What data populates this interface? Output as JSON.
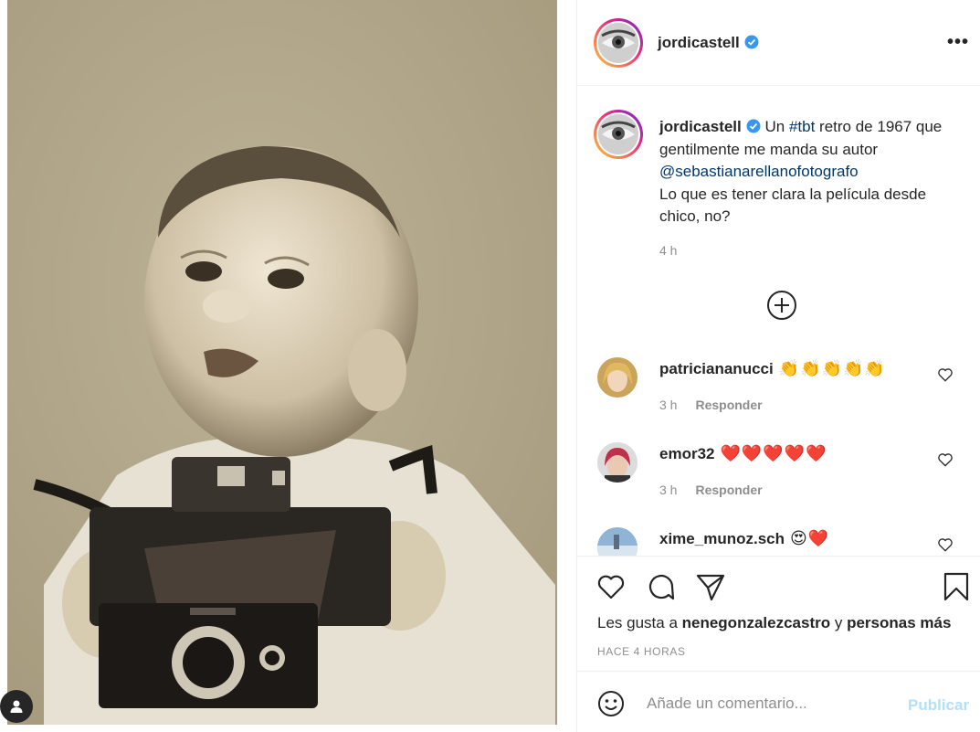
{
  "post": {
    "author": "jordicastell",
    "verified": true,
    "more_icon": "more-horizontal-icon",
    "caption": {
      "text_1": "Un ",
      "hashtag": "#tbt",
      "text_2": " retro de 1967 que gentilmente me manda su autor ",
      "mention": "@sebastianarellanofotografo",
      "text_3": "Lo que es tener clara la película desde chico, no?",
      "time": "4 h"
    },
    "load_more_icon": "plus-circle-icon"
  },
  "comments": [
    {
      "user": "patriciananucci",
      "emoji": "👏👏👏👏👏",
      "time": "3 h",
      "reply": "Responder"
    },
    {
      "user": "emor32",
      "emoji": "❤️❤️❤️❤️❤️",
      "time": "3 h",
      "reply": "Responder"
    },
    {
      "user": "xime_munoz.sch",
      "emoji": "😍❤️",
      "time": "",
      "reply": ""
    }
  ],
  "actions": {
    "icons": [
      "heart-icon",
      "comment-icon",
      "share-icon",
      "bookmark-icon"
    ],
    "likes_prefix": "Les gusta a ",
    "likes_user": "nenegonzalezcastro",
    "likes_mid": " y ",
    "likes_others": "personas más",
    "posted": "HACE 4 HORAS"
  },
  "add_comment": {
    "placeholder": "Añade un comentario...",
    "publish": "Publicar"
  },
  "colors": {
    "link": "#00376b",
    "verified": "#3897f0",
    "publish_disabled": "#b2dffc",
    "photo_sepia": "#b2a78c"
  }
}
